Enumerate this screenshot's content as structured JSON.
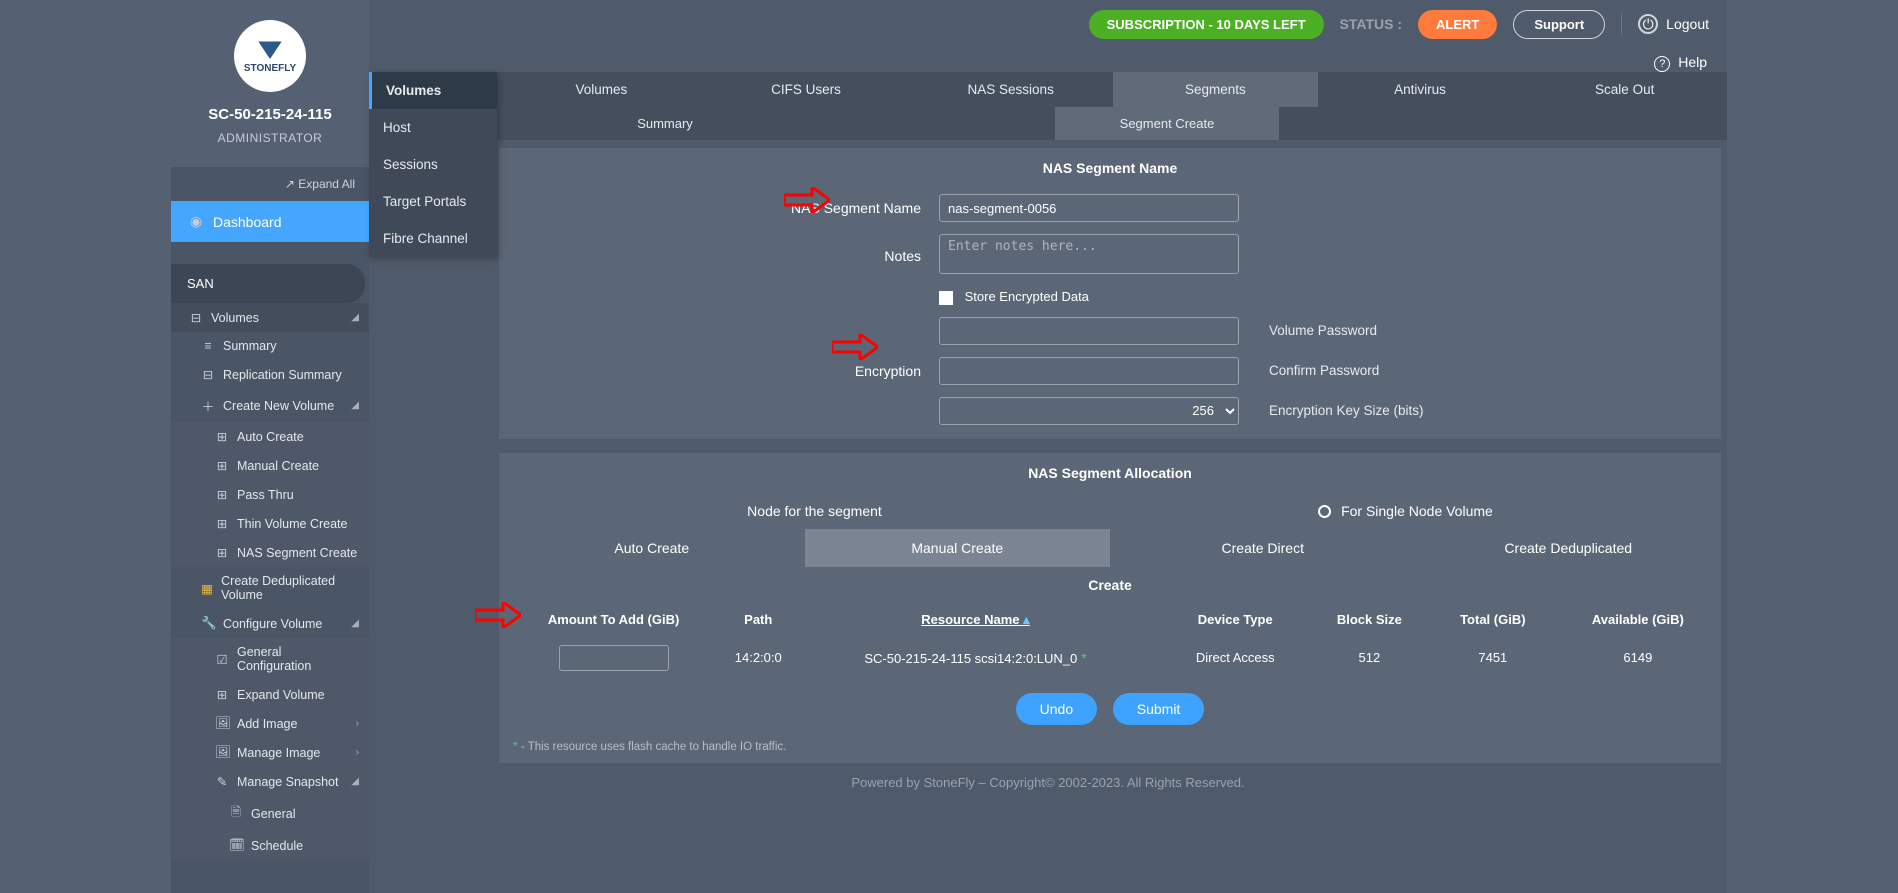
{
  "brand": {
    "text": "STONEFLY"
  },
  "host": "SC-50-215-24-115",
  "role": "ADMINISTRATOR",
  "expand_all": "Expand All",
  "dashboard_label": "Dashboard",
  "san_label": "SAN",
  "sidebar_tree": {
    "volumes": "Volumes",
    "summary": "Summary",
    "replication_summary": "Replication Summary",
    "create_new_volume": "Create New Volume",
    "auto_create": "Auto Create",
    "manual_create": "Manual Create",
    "pass_thru": "Pass Thru",
    "thin_volume_create": "Thin Volume Create",
    "nas_segment_create": "NAS Segment Create",
    "create_dedup_volume": "Create Deduplicated Volume",
    "configure_volume": "Configure Volume",
    "general_configuration": "General Configuration",
    "expand_volume": "Expand Volume",
    "add_image": "Add Image",
    "manage_image": "Manage Image",
    "manage_snapshot": "Manage Snapshot",
    "general": "General",
    "schedule": "Schedule"
  },
  "float_menu": {
    "volumes": "Volumes",
    "host": "Host",
    "sessions": "Sessions",
    "target_portals": "Target Portals",
    "fibre_channel": "Fibre Channel"
  },
  "topbar": {
    "subscription": "SUBSCRIPTION - 10 DAYS LEFT",
    "status_label": "STATUS :",
    "alert": "ALERT",
    "support": "Support",
    "logout": "Logout"
  },
  "help_label": "Help",
  "tabs": {
    "volumes": "Volumes",
    "cifs_users": "CIFS Users",
    "nas_sessions": "NAS Sessions",
    "segments": "Segments",
    "antivirus": "Antivirus",
    "scale_out": "Scale Out"
  },
  "subtabs": {
    "summary": "Summary",
    "segment_create": "Segment Create"
  },
  "seg_name_panel": {
    "title": "NAS Segment Name",
    "name_label": "NAS Segment Name",
    "name_value": "nas-segment-0056",
    "notes_label": "Notes",
    "notes_placeholder": "Enter notes here...",
    "encryption_label": "Encryption",
    "store_encrypted": "Store Encrypted Data",
    "vol_pw_label": "Volume Password",
    "confirm_pw_label": "Confirm Password",
    "key_size_label": "Encryption Key Size (bits)",
    "key_size_value": "256"
  },
  "alloc_panel": {
    "title": "NAS Segment Allocation",
    "node_for_segment": "Node for the segment",
    "single_node": "For Single Node Volume",
    "auto_create": "Auto Create",
    "manual_create": "Manual Create",
    "create_direct": "Create Direct",
    "create_dedup": "Create Deduplicated"
  },
  "create_table": {
    "title": "Create",
    "cols": {
      "amount": "Amount To Add (GiB)",
      "path": "Path",
      "resource": "Resource Name",
      "device_type": "Device Type",
      "block_size": "Block Size",
      "total": "Total (GiB)",
      "available": "Available (GiB)"
    },
    "row": {
      "path": "14:2:0:0",
      "resource": "SC-50-215-24-115 scsi14:2:0:LUN_0",
      "device_type": "Direct Access",
      "block_size": "512",
      "total": "7451",
      "available": "6149"
    }
  },
  "buttons": {
    "undo": "Undo",
    "submit": "Submit"
  },
  "footnote": "- This resource uses flash cache to handle IO traffic.",
  "copyright": "Powered by StoneFly – Copyright© 2002-2023. All Rights Reserved."
}
